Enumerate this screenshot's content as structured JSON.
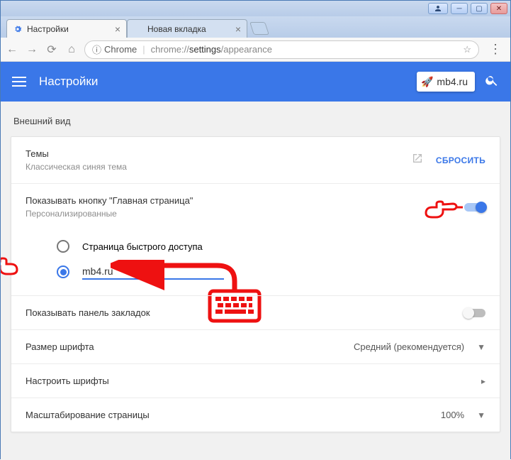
{
  "window": {
    "tabs": [
      {
        "title": "Настройки",
        "favicon": "gear-icon",
        "active": true
      },
      {
        "title": "Новая вкладка",
        "favicon": "blank",
        "active": false
      }
    ]
  },
  "omnibox": {
    "chip": "Chrome",
    "url_prefix": "chrome://",
    "url_bold": "settings",
    "url_suffix": "/appearance"
  },
  "header": {
    "title": "Настройки",
    "pill_text": "mb4.ru"
  },
  "appearance": {
    "section_title": "Внешний вид",
    "theme": {
      "title": "Темы",
      "subtitle": "Классическая синяя тема",
      "reset_label": "СБРОСИТЬ"
    },
    "home_button": {
      "title": "Показывать кнопку \"Главная страница\"",
      "subtitle": "Персонализированные",
      "enabled": true,
      "options": {
        "ntp_label": "Страница быстрого доступа",
        "custom_value": "mb4.ru"
      }
    },
    "bookmarks_bar": {
      "title": "Показывать панель закладок",
      "enabled": false
    },
    "font_size": {
      "title": "Размер шрифта",
      "value": "Средний (рекомендуется)"
    },
    "customize_fonts": {
      "title": "Настроить шрифты"
    },
    "page_zoom": {
      "title": "Масштабирование страницы",
      "value": "100%"
    }
  }
}
